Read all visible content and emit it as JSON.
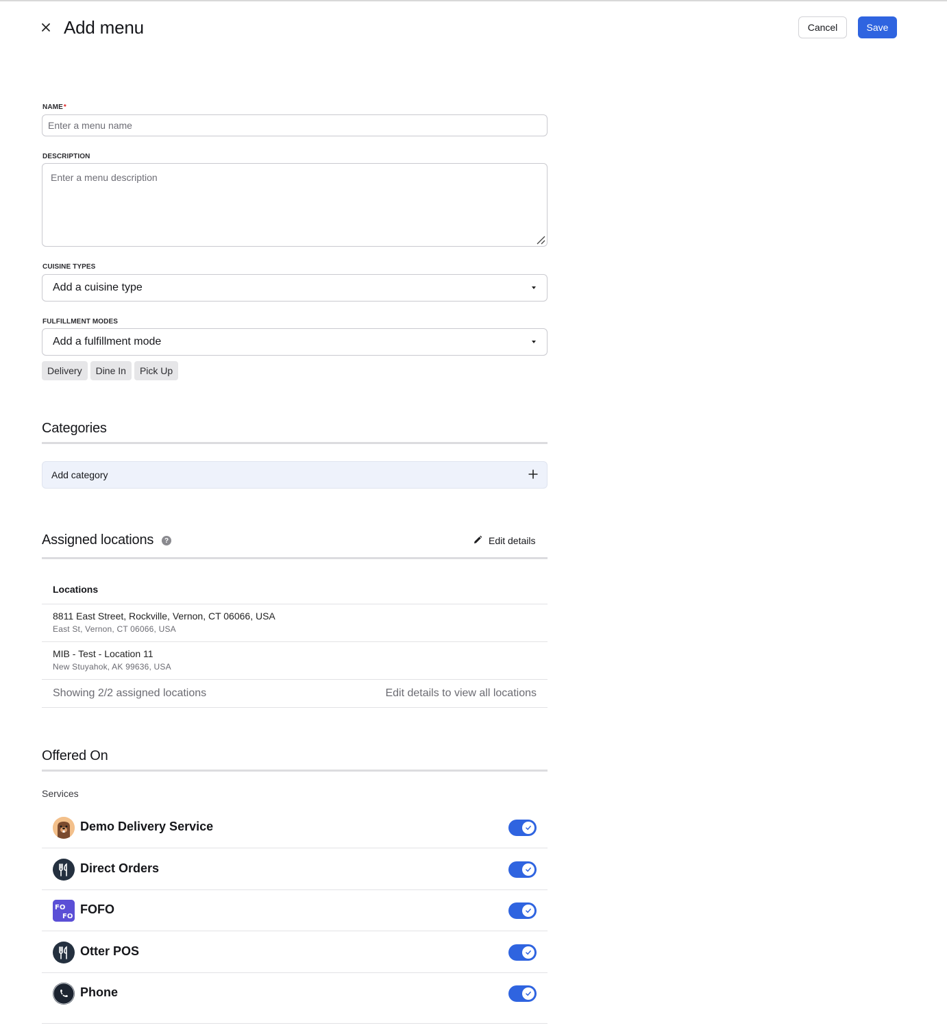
{
  "header": {
    "title": "Add menu",
    "cancel_label": "Cancel",
    "save_label": "Save"
  },
  "form": {
    "name": {
      "label": "NAME",
      "required_mark": "*",
      "placeholder": "Enter a menu name",
      "value": ""
    },
    "description": {
      "label": "DESCRIPTION",
      "placeholder": "Enter a menu description",
      "value": ""
    },
    "cuisine": {
      "label": "CUISINE TYPES",
      "placeholder": "Add a cuisine type"
    },
    "fulfillment": {
      "label": "FULFILLMENT MODES",
      "placeholder": "Add a fulfillment mode",
      "chips": [
        "Delivery",
        "Dine In",
        "Pick Up"
      ]
    }
  },
  "categories": {
    "title": "Categories",
    "add_label": "Add category"
  },
  "locations": {
    "title": "Assigned locations",
    "help_icon": "question-circle-icon",
    "edit_label": "Edit details",
    "column_header": "Locations",
    "rows": [
      {
        "main": "8811 East Street, Rockville, Vernon, CT 06066, USA",
        "sub": "East St, Vernon, CT 06066, USA"
      },
      {
        "main": "MIB - Test - Location 11",
        "sub": "New Stuyahok, AK 99636, USA"
      }
    ],
    "footer_left": "Showing 2/2 assigned locations",
    "footer_right": "Edit details to view all locations"
  },
  "offered_on": {
    "title": "Offered On",
    "services_label": "Services",
    "services": [
      {
        "name": "Demo Delivery Service",
        "icon": "beaver-avatar-icon",
        "enabled": true
      },
      {
        "name": "Direct Orders",
        "icon": "fork-knife-icon",
        "enabled": true
      },
      {
        "name": "FOFO",
        "icon": "fofo-logo-icon",
        "enabled": true
      },
      {
        "name": "Otter POS",
        "icon": "fork-knife-icon",
        "enabled": true
      },
      {
        "name": "Phone",
        "icon": "phone-icon",
        "enabled": true
      }
    ]
  },
  "colors": {
    "primary": "#2f64e0",
    "add_category_bg": "#eef2fb",
    "chip_bg": "#e6e6e8"
  }
}
